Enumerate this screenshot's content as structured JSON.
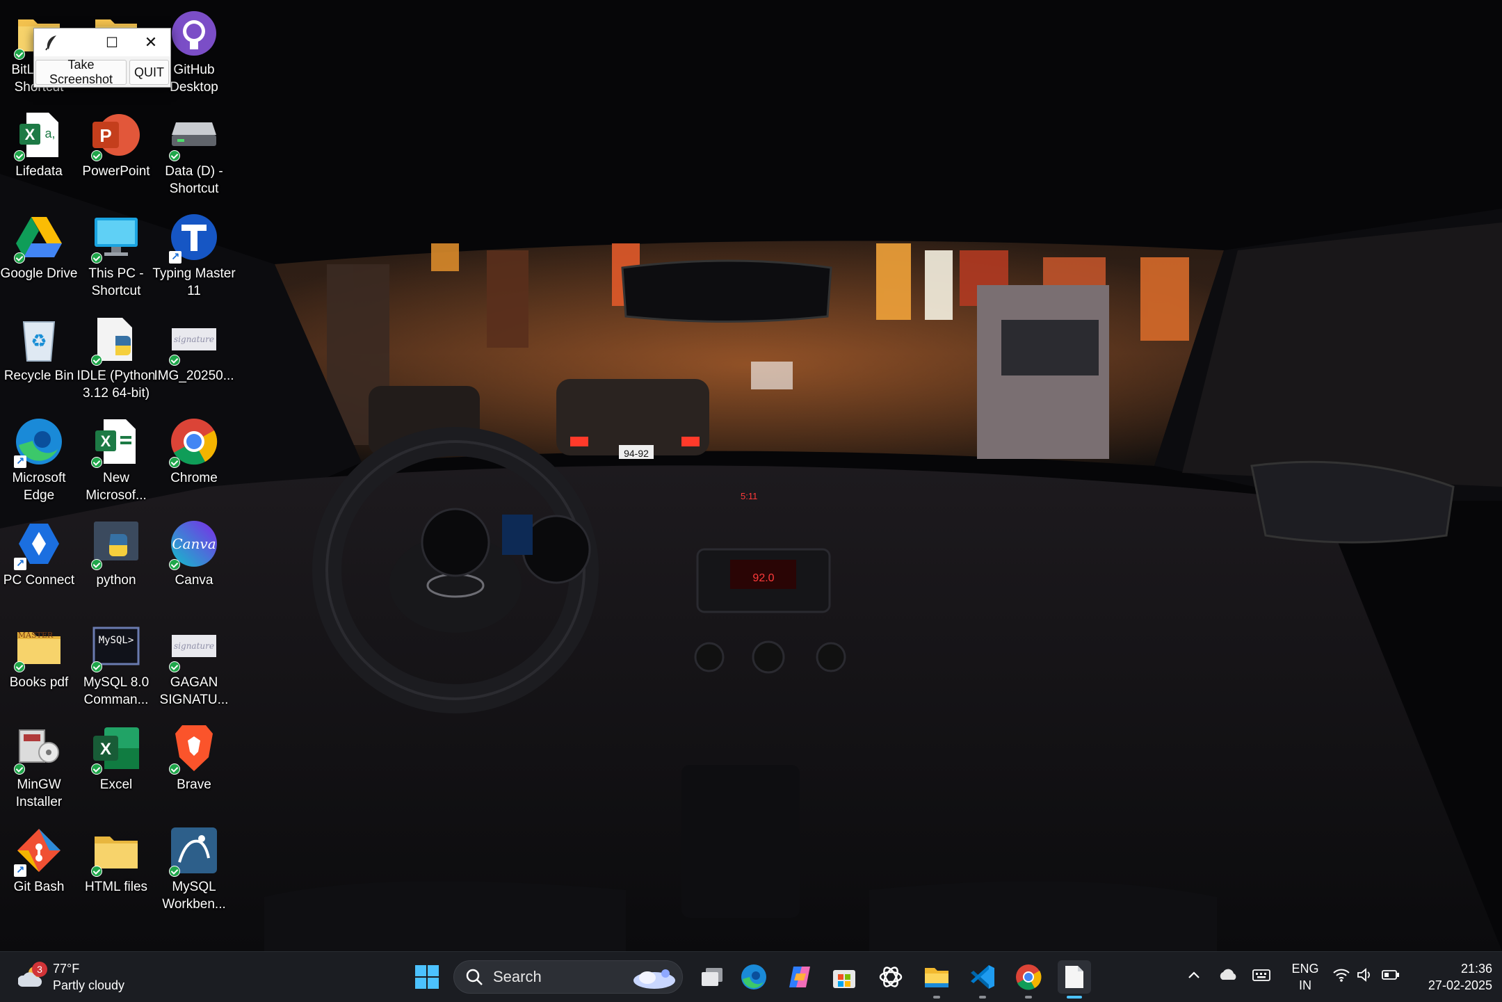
{
  "desktop": {
    "icons": [
      {
        "label": "BitLocker Shortcut"
      },
      {
        "label": ""
      },
      {
        "label": "GitHub Desktop"
      },
      {
        "label": "Lifedata"
      },
      {
        "label": "PowerPoint"
      },
      {
        "label": "Data (D) - Shortcut"
      },
      {
        "label": "Google Drive"
      },
      {
        "label": "This PC - Shortcut"
      },
      {
        "label": "Typing Master 11"
      },
      {
        "label": "Recycle Bin"
      },
      {
        "label": "IDLE (Python 3.12 64-bit)"
      },
      {
        "label": "IMG_20250..."
      },
      {
        "label": "Microsoft Edge"
      },
      {
        "label": "New Microsof..."
      },
      {
        "label": "Chrome"
      },
      {
        "label": "PC Connect"
      },
      {
        "label": "python"
      },
      {
        "label": "Canva"
      },
      {
        "label": "Books pdf"
      },
      {
        "label": "MySQL 8.0 Comman..."
      },
      {
        "label": "GAGAN SIGNATU..."
      },
      {
        "label": "MinGW Installer"
      },
      {
        "label": "Excel"
      },
      {
        "label": "Brave"
      },
      {
        "label": "Git Bash"
      },
      {
        "label": "HTML files"
      },
      {
        "label": "MySQL Workben..."
      }
    ],
    "wallpaper": {
      "radio_display": "92.0",
      "plate": "94-92",
      "clock_display": "5:11"
    }
  },
  "tool_window": {
    "minimize_glyph": "—",
    "maximize_glyph": "☐",
    "close_glyph": "✕",
    "screenshot_label": "Take Screenshot",
    "quit_label": "QUIT"
  },
  "taskbar": {
    "weather": {
      "temp": "77°F",
      "condition": "Partly cloudy",
      "badge": "3"
    },
    "search_placeholder": "Search",
    "apps": [
      "start-icon",
      "task-view-icon",
      "edge-icon",
      "copilot-icon",
      "store-icon",
      "chatgpt-icon",
      "file-explorer-icon",
      "vscode-icon",
      "chrome-icon",
      "notepad-icon"
    ],
    "language": {
      "line1": "ENG",
      "line2": "IN"
    },
    "time": "21:36",
    "date": "27-02-2025"
  },
  "colors": {
    "taskbar_bg": "#1b1d22",
    "accent": "#4cc2ff"
  }
}
